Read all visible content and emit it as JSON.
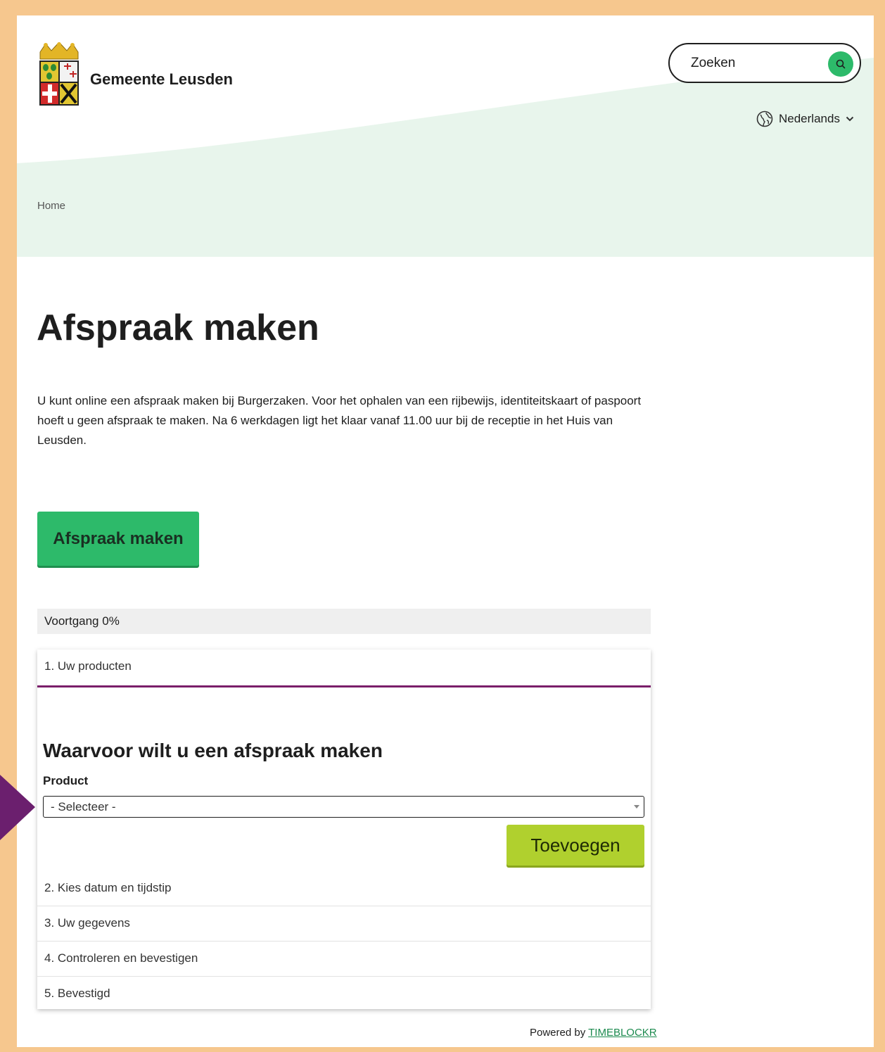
{
  "header": {
    "site_name": "Gemeente Leusden",
    "search_placeholder": "Zoeken",
    "search_icon": "search-icon",
    "language": "Nederlands",
    "language_icon": "globe-icon"
  },
  "breadcrumb": {
    "home": "Home"
  },
  "main": {
    "title": "Afspraak maken",
    "intro": "U kunt online een afspraak maken bij Burgerzaken. Voor het ophalen van een rijbewijs, identiteitskaart of paspoort hoeft u geen afspraak te maken. Na 6 werkdagen ligt het klaar vanaf 11.00 uur bij de receptie in het Huis van Leusden.",
    "cta_label": "Afspraak maken"
  },
  "progress": {
    "label": "Voortgang 0%",
    "value": 0
  },
  "steps": {
    "items": [
      {
        "label": "1. Uw producten"
      },
      {
        "label": "2. Kies datum en tijdstip"
      },
      {
        "label": "3. Uw gegevens"
      },
      {
        "label": "4. Controleren en bevestigen"
      },
      {
        "label": "5. Bevestigd"
      }
    ],
    "question": "Waarvoor wilt u een afspraak maken",
    "product_label": "Product",
    "select_value": "- Selecteer -",
    "add_label": "Toevoegen"
  },
  "footer": {
    "powered_by": "Powered by",
    "vendor": "TIMEBLOCKR"
  },
  "colors": {
    "accent_green": "#2dba6a",
    "active_step": "#7a1f6a",
    "add_button": "#b0d02e",
    "header_wave": "#e8f5ec",
    "frame": "#f6c78e",
    "arrow": "#6b1f6e"
  }
}
